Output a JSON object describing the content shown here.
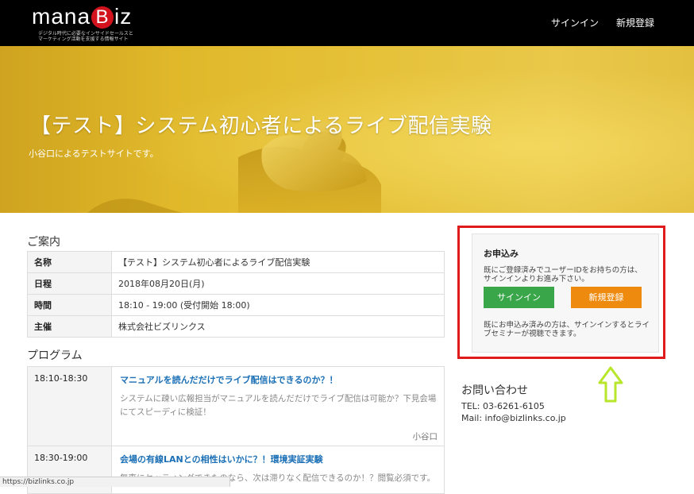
{
  "header": {
    "logo_prefix": "mana",
    "logo_b": "B",
    "logo_suffix": "iz",
    "logo_tagline_1": "デジタル時代に必要なインサイドセールスと",
    "logo_tagline_2": "マーケティング活動を支援する情報サイト",
    "nav_signin": "サインイン",
    "nav_register": "新規登録"
  },
  "hero": {
    "title": "【テスト】システム初心者によるライブ配信実験",
    "subtitle": "小谷口によるテストサイトです。"
  },
  "info": {
    "section_title": "ご案内",
    "rows": [
      {
        "key": "名称",
        "value": "【テスト】システム初心者によるライブ配信実験"
      },
      {
        "key": "日程",
        "value": "2018年08月20日(月)"
      },
      {
        "key": "時間",
        "value": "18:10 - 19:00 (受付開始 18:00)"
      },
      {
        "key": "主催",
        "value": "株式会社ビズリンクス"
      }
    ]
  },
  "program": {
    "section_title": "プログラム",
    "items": [
      {
        "time": "18:10-18:30",
        "title": "マニュアルを読んだだけでライブ配信はできるのか？！",
        "desc": "システムに疎い広報担当がマニュアルを読んだだけでライブ配信は可能か？下見会場にてスピーディに検証！",
        "speaker": "小谷口"
      },
      {
        "time": "18:30-19:00",
        "title": "会場の有線LANとの相性はいかに？！環境実証実験",
        "desc": "無事にセッティングできたのなら、次は滞りなく配信できるのか！？閲覧必須です。",
        "speaker": ""
      }
    ]
  },
  "apply": {
    "title": "お申込み",
    "text1": "既にご登録済みでユーザーIDをお持ちの方は、サインインよりお進み下さい。",
    "signin_label": "サインイン",
    "register_label": "新規登録",
    "text2": "既にお申込み済みの方は、サインインするとライブセミナーが視聴できます。"
  },
  "contact": {
    "title": "お問い合わせ",
    "tel": "TEL: 03-6261-6105",
    "mail": "Mail: info@bizlinks.co.jp"
  },
  "status_bar": {
    "url": "https://bizlinks.co.jp"
  },
  "colors": {
    "header_bg": "#000000",
    "logo_accent": "#d2131d",
    "hero_yellow": "#e0b82a",
    "link_blue": "#1a6fb5",
    "signin_green": "#3aa64a",
    "register_orange": "#ee8a0e",
    "highlight_red": "#e01b1b",
    "arrow_green": "#b7e62a"
  },
  "icons": {
    "annotation_arrow": "up-arrow-icon"
  }
}
